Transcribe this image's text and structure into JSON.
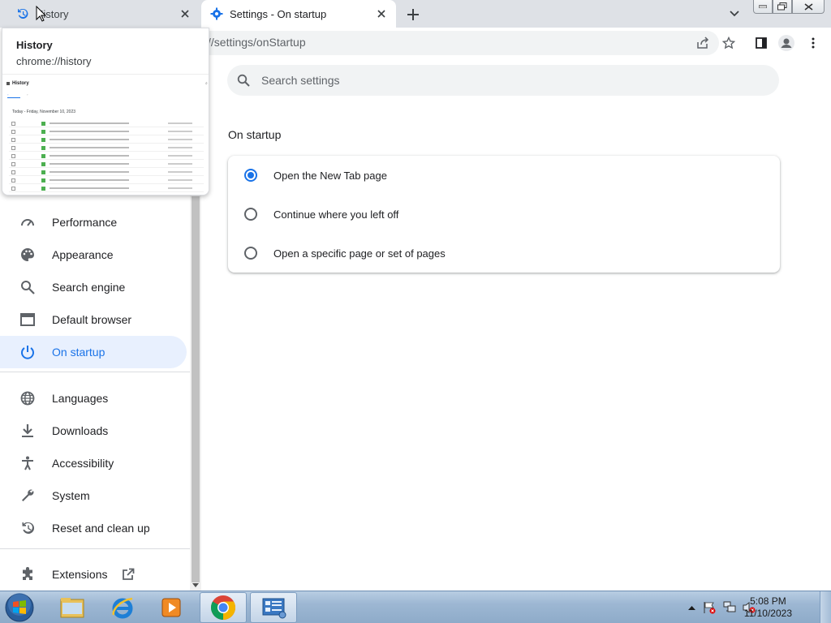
{
  "tabs": [
    {
      "title": "History",
      "icon": "history-icon"
    },
    {
      "title": "Settings - On startup",
      "icon": "gear-icon"
    }
  ],
  "hovercard": {
    "title": "History",
    "url": "chrome://history",
    "preview": {
      "title": "History",
      "date": "Today - Friday, November 10, 2023"
    }
  },
  "omnibox": {
    "url_visible": "//settings/onStartup"
  },
  "search": {
    "placeholder": "Search settings"
  },
  "sidebar": {
    "items": [
      {
        "label": "Performance",
        "icon": "speedometer-icon"
      },
      {
        "label": "Appearance",
        "icon": "palette-icon"
      },
      {
        "label": "Search engine",
        "icon": "search-icon"
      },
      {
        "label": "Default browser",
        "icon": "browser-window-icon"
      },
      {
        "label": "On startup",
        "icon": "power-icon",
        "active": true
      },
      {
        "label": "Languages",
        "icon": "globe-icon"
      },
      {
        "label": "Downloads",
        "icon": "download-icon"
      },
      {
        "label": "Accessibility",
        "icon": "accessibility-icon"
      },
      {
        "label": "System",
        "icon": "wrench-icon"
      },
      {
        "label": "Reset and clean up",
        "icon": "reset-history-icon"
      },
      {
        "label": "Extensions",
        "icon": "puzzle-icon"
      }
    ]
  },
  "main": {
    "section_title": "On startup",
    "options": [
      {
        "label": "Open the New Tab page",
        "selected": true
      },
      {
        "label": "Continue where you left off",
        "selected": false
      },
      {
        "label": "Open a specific page or set of pages",
        "selected": false
      }
    ]
  },
  "taskbar": {
    "time": "5:08 PM",
    "date": "11/10/2023"
  },
  "colors": {
    "accent": "#1a73e8",
    "active_nav_bg": "#e8f0fe",
    "tabstrip_bg": "#dee1e6"
  }
}
